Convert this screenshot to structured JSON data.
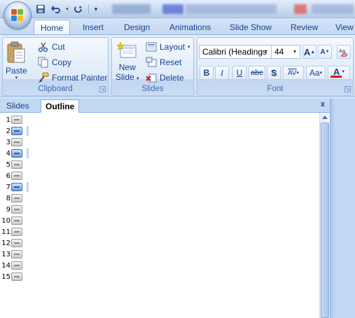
{
  "title_bar": {
    "qat_icons": [
      "save-icon",
      "undo-icon",
      "redo-icon",
      "customize-icon"
    ]
  },
  "tabs": [
    {
      "label": "Home",
      "active": true
    },
    {
      "label": "Insert",
      "active": false
    },
    {
      "label": "Design",
      "active": false
    },
    {
      "label": "Animations",
      "active": false
    },
    {
      "label": "Slide Show",
      "active": false
    },
    {
      "label": "Review",
      "active": false
    },
    {
      "label": "View",
      "active": false
    }
  ],
  "clipboard": {
    "paste": "Paste",
    "cut": "Cut",
    "copy": "Copy",
    "format_painter": "Format Painter",
    "label": "Clipboard"
  },
  "slides_group": {
    "new_slide_line1": "New",
    "new_slide_line2": "Slide",
    "layout": "Layout",
    "reset": "Reset",
    "delete": "Delete",
    "label": "Slides"
  },
  "font_group": {
    "font_name": "Calibri (Headings",
    "font_size": "44",
    "bold": "B",
    "italic": "I",
    "underline": "U",
    "strikethrough": "abc",
    "shadow": "S",
    "char_spacing": "AV",
    "change_case": "Aa",
    "font_color": "A",
    "grow": "A",
    "shrink": "A",
    "label": "Font"
  },
  "pane": {
    "tab_slides": "Slides",
    "tab_outline": "Outline",
    "close": "x"
  },
  "outline_rows": [
    {
      "num": "1",
      "selected": false
    },
    {
      "num": "2",
      "selected": true
    },
    {
      "num": "3",
      "selected": false
    },
    {
      "num": "4",
      "selected": true
    },
    {
      "num": "5",
      "selected": false
    },
    {
      "num": "6",
      "selected": false
    },
    {
      "num": "7",
      "selected": true
    },
    {
      "num": "8",
      "selected": false
    },
    {
      "num": "9",
      "selected": false
    },
    {
      "num": "10",
      "selected": false
    },
    {
      "num": "11",
      "selected": false
    },
    {
      "num": "12",
      "selected": false
    },
    {
      "num": "13",
      "selected": false
    },
    {
      "num": "14",
      "selected": false
    },
    {
      "num": "15",
      "selected": false
    }
  ],
  "colors": {
    "accent": "#15428b",
    "ribbon_bg": "#d3e3f7",
    "font_color_bar": "#e01010"
  }
}
